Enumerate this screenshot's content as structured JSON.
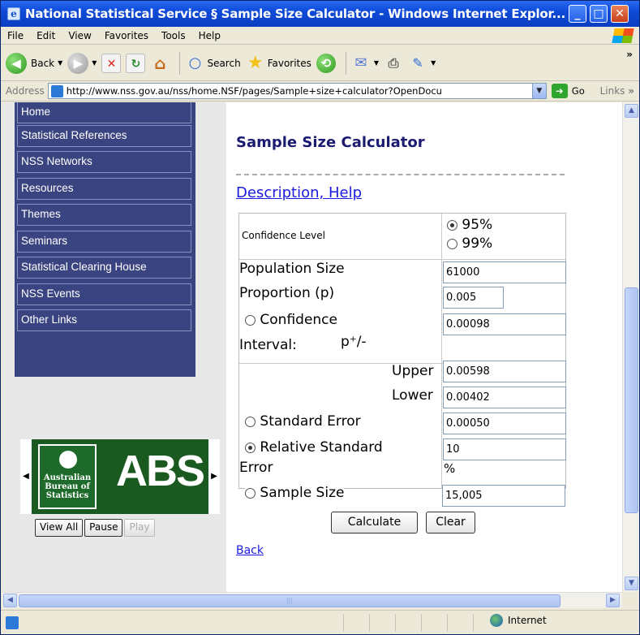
{
  "window": {
    "title": "National Statistical Service § Sample Size Calculator - Windows Internet Explor...",
    "minimize": "_",
    "maximize": "□",
    "close": "✕"
  },
  "menu": [
    "File",
    "Edit",
    "View",
    "Favorites",
    "Tools",
    "Help"
  ],
  "toolbar": {
    "back": "Back",
    "search": "Search",
    "favorites": "Favorites",
    "overflow": "»"
  },
  "address": {
    "label": "Address",
    "url": "http://www.nss.gov.au/nss/home.NSF/pages/Sample+size+calculator?OpenDocu",
    "go": "Go",
    "links": "Links"
  },
  "sidebar": {
    "items": [
      "Home",
      "Statistical References",
      "NSS Networks",
      "Resources",
      "Themes",
      "Seminars",
      "Statistical Clearing House",
      "NSS Events",
      "Other Links"
    ]
  },
  "slideshow": {
    "panel_text": "Australian Bureau of Statistics",
    "logo_text": "ABS",
    "buttons": [
      "View All",
      "Pause",
      "Play"
    ]
  },
  "page": {
    "title": "Sample Size Calculator",
    "description_link": "Description, Help",
    "back_link": "Back"
  },
  "form": {
    "confidence_level_label": "Confidence Level",
    "confidence_options": [
      "95%",
      "99%"
    ],
    "confidence_selected": "95%",
    "population_label": "Population Size",
    "population_value": "61000",
    "proportion_label": "Proportion (p)",
    "proportion_value": "0.005",
    "ci_label": "Confidence",
    "ci_label2": "Interval:",
    "ci_symbol": "p⁺/-",
    "ci_value": "0.00098",
    "upper_label": "Upper",
    "upper_value": "0.00598",
    "lower_label": "Lower",
    "lower_value": "0.00402",
    "se_label": "Standard Error",
    "se_value": "0.00050",
    "rse_label": "Relative Standard",
    "rse_label2": "Error",
    "rse_value": "10",
    "rse_unit": "%",
    "sample_label": "Sample Size",
    "sample_value": "15,005",
    "calculate": "Calculate",
    "clear": "Clear"
  },
  "status": {
    "zone": "Internet"
  }
}
